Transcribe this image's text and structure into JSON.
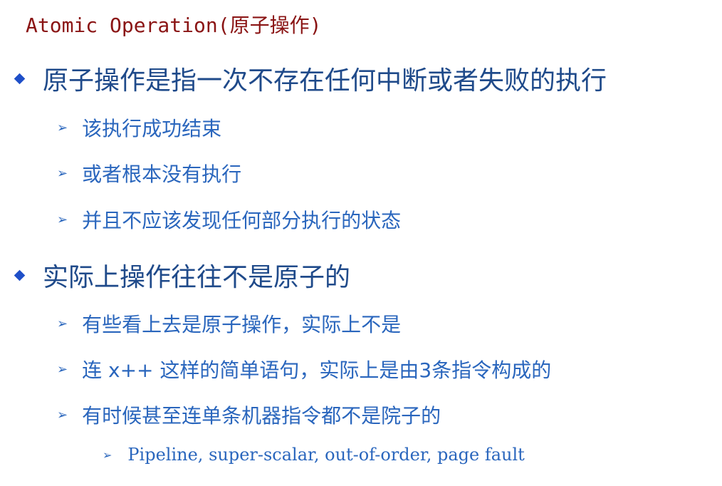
{
  "slide": {
    "title": "Atomic Operation(原子操作)",
    "bullets": [
      {
        "text": "原子操作是指一次不存在任何中断或者失败的执行",
        "sub": [
          "该执行成功结束",
          "或者根本没有执行",
          "并且不应该发现任何部分执行的状态"
        ]
      },
      {
        "text": "实际上操作往往不是原子的",
        "sub": [
          "有些看上去是原子操作，实际上不是",
          "连 x++ 这样的简单语句，实际上是由3条指令构成的",
          "有时候甚至连单条机器指令都不是院子的"
        ],
        "subsub": [
          "Pipeline, super-scalar, out-of-order, page fault"
        ]
      }
    ]
  },
  "colors": {
    "title": "#8a1414",
    "level1_text": "#1f4a8a",
    "level2_text": "#2a66bd",
    "bullet_diamond": "#1f4fc8"
  },
  "icons": {
    "level1_bullet": "diamond-bullet-icon",
    "level2_bullet": "arrow-bullet-icon"
  }
}
